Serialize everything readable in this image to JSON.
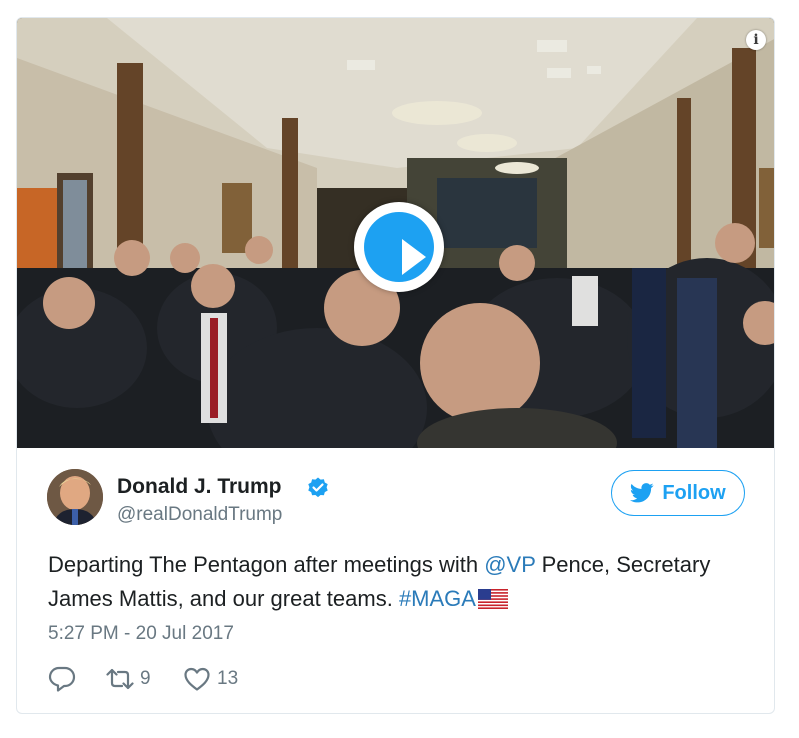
{
  "media": {
    "info_icon": "info-icon",
    "play_icon": "play-icon"
  },
  "tweet": {
    "author_name": "Donald J. Trump",
    "handle": "@realDonaldTrump",
    "follow_label": "Follow",
    "text_parts": [
      "Departing The Pentagon after meetings with ",
      "@VP",
      " Pence, Secretary James Mattis, and our great teams. ",
      "#MAGA"
    ],
    "timestamp": "5:27 PM - 20 Jul 2017",
    "retweet_count": "9",
    "like_count": "13"
  },
  "colors": {
    "accent": "#1da1f2",
    "link": "#2b7bb9",
    "secondary_text": "#697882",
    "border": "#e1e8ed"
  }
}
